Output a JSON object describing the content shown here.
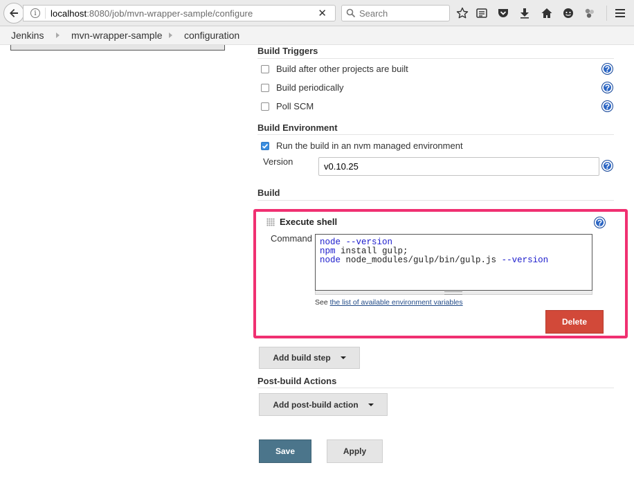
{
  "browser": {
    "url_host": "localhost",
    "url_path": ":8080/job/mvn-wrapper-sample/configure",
    "search_placeholder": "Search",
    "clear_symbol": "✕"
  },
  "breadcrumb": [
    "Jenkins",
    "mvn-wrapper-sample",
    "configuration"
  ],
  "build_triggers": {
    "title": "Build Triggers",
    "options": [
      {
        "label": "Build after other projects are built",
        "checked": false
      },
      {
        "label": "Build periodically",
        "checked": false
      },
      {
        "label": "Poll SCM",
        "checked": false
      }
    ]
  },
  "build_environment": {
    "title": "Build Environment",
    "nvm_option": {
      "label": "Run the build in an nvm managed environment",
      "checked": true
    },
    "version_label": "Version",
    "version_value": "v0.10.25"
  },
  "build": {
    "title": "Build",
    "step_title": "Execute shell",
    "command_label": "Command",
    "command_lines": [
      [
        {
          "t": "node",
          "kw": true
        },
        {
          "t": " "
        },
        {
          "t": "--version",
          "kw": true
        }
      ],
      [
        {
          "t": "npm",
          "kw": true
        },
        {
          "t": " install gulp;"
        }
      ],
      [
        {
          "t": "node",
          "kw": true
        },
        {
          "t": " node_modules/gulp/bin/gulp.js "
        },
        {
          "t": "--version",
          "kw": true
        }
      ]
    ],
    "env_note_prefix": "See ",
    "env_note_link": "the list of available environment variables",
    "delete_label": "Delete",
    "add_step_label": "Add build step"
  },
  "post_build": {
    "title": "Post-build Actions",
    "add_action_label": "Add post-build action"
  },
  "actions": {
    "save_label": "Save",
    "apply_label": "Apply"
  },
  "help_symbol": "?",
  "colors": {
    "highlight": "#f03071",
    "delete": "#d24939",
    "save": "#4b758b",
    "help": "#2a65c4"
  }
}
